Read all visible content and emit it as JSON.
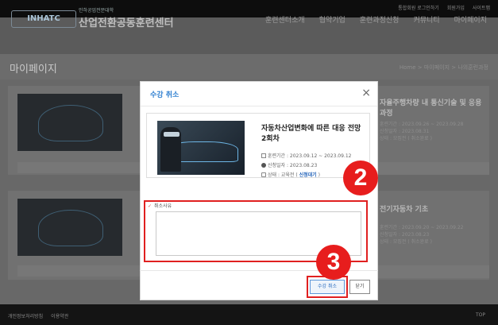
{
  "header": {
    "top_links": [
      "통합회원 로그인하기",
      "회원가입",
      "사이트맵"
    ],
    "logo_text": "INHATC",
    "logo_subtitle": "인하공업전문대학",
    "site_title": "산업전환공동훈련센터",
    "nav": [
      "훈련센터소개",
      "협약기업",
      "훈련과정신청",
      "커뮤니티",
      "마이페이지"
    ]
  },
  "page": {
    "title": "마이페이지",
    "breadcrumb": "Home > 마이페이지 > 나의훈련과정"
  },
  "background_cards": [
    {
      "title": "자율주행차량 내 통신기술 및 응용과정",
      "meta": [
        "훈련기간 : 2023.09.26 ~ 2023.09.28",
        "신청일자 : 2023.08.31",
        "상태 : 모집전 ( 취소완료 )"
      ]
    },
    {
      "title": "전기자동차 기초",
      "meta": [
        "훈련기간 : 2023.09.20 ~ 2023.09.22",
        "신청일자 : 2023.08.23",
        "상태 : 모집전 ( 취소완료 )"
      ]
    }
  ],
  "modal": {
    "title": "수강 취소",
    "close_icon": "×",
    "course_name": "자동차산업변화에 따른 대응 전망 2회차",
    "period_label": "훈련기간 : 2023.09.12 ~ 2023.09.12",
    "apply_date_label": "신청일자 : 2023.08.23",
    "status_prefix": "상태 : 교육전 (",
    "status_value": "신청대기",
    "status_suffix": ")",
    "reason_label": "취소사유",
    "reason_value": "",
    "cancel_button": "수강 취소",
    "close_button": "닫기"
  },
  "annotations": {
    "step2": "2",
    "step3": "3",
    "highlight_color": "#e02020"
  },
  "footer": {
    "links": [
      "개인정보처리방침",
      "이용약관"
    ],
    "top": "TOP"
  }
}
